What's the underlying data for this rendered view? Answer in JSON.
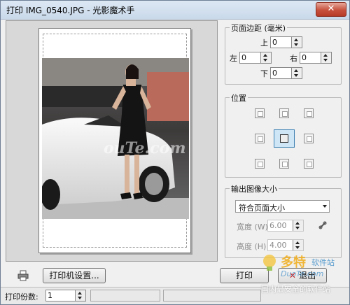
{
  "window": {
    "title": "打印 IMG_0540.JPG - 光影魔术手",
    "close_glyph": "✕"
  },
  "margins": {
    "group_title": "页面边距 (毫米)",
    "top_label": "上",
    "top_value": "0",
    "left_label": "左",
    "left_value": "0",
    "right_label": "右",
    "right_value": "0",
    "bottom_label": "下",
    "bottom_value": "0"
  },
  "position": {
    "group_title": "位置",
    "selected": "center"
  },
  "output": {
    "group_title": "输出图像大小",
    "mode_value": "符合页面大小",
    "width_label": "宽度 (W)",
    "width_value": "6.00",
    "height_label": "高度 (H)",
    "height_value": "4.00"
  },
  "buttons": {
    "printer_setup": "打印机设置...",
    "print": "打印",
    "exit": "退出"
  },
  "status": {
    "copies_label": "打印份数:",
    "copies_value": "1"
  },
  "watermark": {
    "site_text": "ouTe.com",
    "logo_text": "多特",
    "logo_sub": "软件站",
    "logo_domain": "DuoTe.com",
    "slogan": "国内最安全的软件站"
  }
}
